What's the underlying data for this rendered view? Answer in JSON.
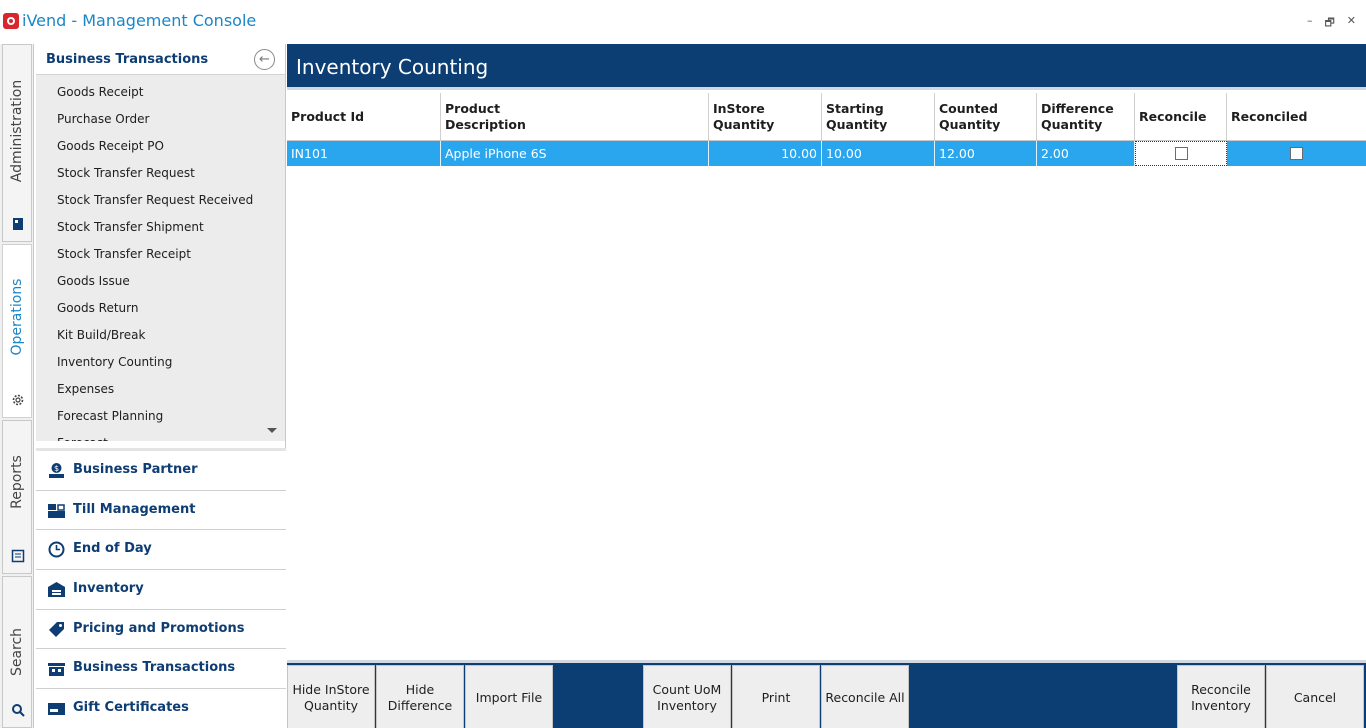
{
  "window": {
    "title": "iVend - Management Console",
    "minimize_glyph": "–",
    "restore_glyph": "🗗",
    "close_glyph": "✕"
  },
  "vertical_tabs": [
    {
      "label": "Administration",
      "icon": "id-card-icon",
      "active": false
    },
    {
      "label": "Operations",
      "icon": "gear-icon",
      "active": true
    },
    {
      "label": "Reports",
      "icon": "report-icon",
      "active": false
    },
    {
      "label": "Search",
      "icon": "search-icon",
      "active": false
    }
  ],
  "nav": {
    "header": "Business Transactions",
    "back_glyph": "←",
    "items": [
      "Goods Receipt",
      "Purchase Order",
      "Goods Receipt PO",
      "Stock Transfer Request",
      "Stock Transfer Request Received",
      "Stock Transfer Shipment",
      "Stock Transfer Receipt",
      "Goods Issue",
      "Goods Return",
      "Kit Build/Break",
      "Inventory Counting",
      "Expenses",
      "Forecast Planning",
      "Forecast"
    ],
    "sections": [
      {
        "label": "Business Partner",
        "icon": "partner-icon"
      },
      {
        "label": "Till Management",
        "icon": "register-icon"
      },
      {
        "label": "End of Day",
        "icon": "clock-icon"
      },
      {
        "label": "Inventory",
        "icon": "warehouse-icon"
      },
      {
        "label": "Pricing and Promotions",
        "icon": "tag-icon"
      },
      {
        "label": "Business Transactions",
        "icon": "store-icon"
      },
      {
        "label": "Gift Certificates",
        "icon": "gift-card-icon"
      }
    ]
  },
  "main": {
    "title": "Inventory Counting",
    "columns": [
      "Product Id",
      "Product\nDescription",
      "InStore\nQuantity",
      "Starting\nQuantity",
      "Counted\nQuantity",
      "Difference\nQuantity",
      "Reconcile",
      "Reconciled"
    ],
    "rows": [
      {
        "product_id": "IN101",
        "description": "Apple iPhone 6S",
        "instore_qty": "10.00",
        "starting_qty": "10.00",
        "counted_qty": "12.00",
        "difference_qty": "2.00",
        "reconcile": false,
        "reconciled": false
      }
    ]
  },
  "toolbar": {
    "hide_instore": "Hide InStore\nQuantity",
    "hide_difference": "Hide\nDifference",
    "import_file": "Import File",
    "count_uom": "Count UoM\nInventory",
    "print": "Print",
    "reconcile_all": "Reconcile All",
    "reconcile_inventory": "Reconcile\nInventory",
    "cancel": "Cancel"
  },
  "colors": {
    "header_bg": "#0c3d73",
    "selection": "#2aa6ef",
    "title_text": "#1a86c8"
  }
}
